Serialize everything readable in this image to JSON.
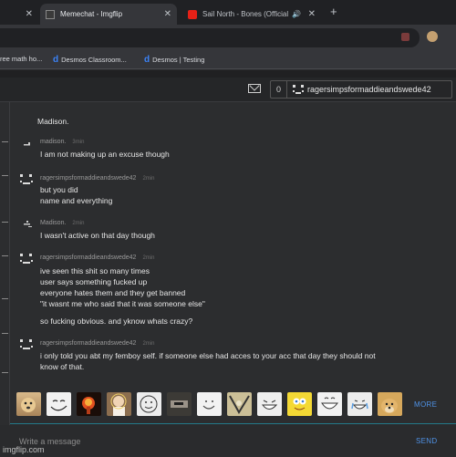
{
  "browser": {
    "tabs": [
      {
        "label": "",
        "icon": "close-icon"
      },
      {
        "label": "Memechat - Imgflip",
        "icon": "imgflip-icon"
      },
      {
        "label": "Sail North - Bones (Official",
        "icon": "youtube-icon"
      }
    ],
    "new_tab": "+",
    "bookmarks": [
      {
        "label": "ree math ho..."
      },
      {
        "label": "Desmos Classroom...",
        "icon": "d"
      },
      {
        "label": "Desmos | Testing",
        "icon": "d"
      }
    ]
  },
  "header": {
    "unread_count": "0",
    "username": "ragersimpsformaddieandswede42"
  },
  "messages": [
    {
      "lines": [
        "Madison."
      ]
    },
    {
      "user": "madison.",
      "time": "3min",
      "lines": [
        "I am not making up an excuse though"
      ]
    },
    {
      "user": "ragersimpsformaddieandswede42",
      "time": "2min",
      "lines": [
        "but you did",
        "name and everything"
      ]
    },
    {
      "user": "Madison.",
      "time": "2min",
      "lines": [
        "I wasn't active on that day though"
      ]
    },
    {
      "user": "ragersimpsformaddieandswede42",
      "time": "2min",
      "lines": [
        "ive seen this shit so many times",
        "user says something fucked up",
        "everyone hates them and they get banned",
        "\"it wasnt me who said that it was someone else\""
      ]
    },
    {
      "lines": [
        "so fucking obvious. and yknow whats crazy?"
      ]
    },
    {
      "user": "ragersimpsformaddieandswede42",
      "time": "2min",
      "lines": [
        "i only told you abt my femboy self. if someone else had acces to your acc that day they should not",
        "know of that."
      ]
    }
  ],
  "emojis": [
    "doge-face",
    "troll-face",
    "explosion",
    "jesus-thumbs-up",
    "smiling-face",
    "dark-meme",
    "happy-face",
    "rage-face",
    "laughing-face",
    "spongebob-face",
    "lol-face",
    "crying-laugh-face",
    "doge-face"
  ],
  "emoji_more": "MORE",
  "composer": {
    "placeholder": "Write a message",
    "send": "SEND"
  },
  "watermark": "imgflip.com",
  "colors": {
    "accent": "#4f92e6",
    "background": "#2c2d2f",
    "text": "#e6e6e6"
  }
}
